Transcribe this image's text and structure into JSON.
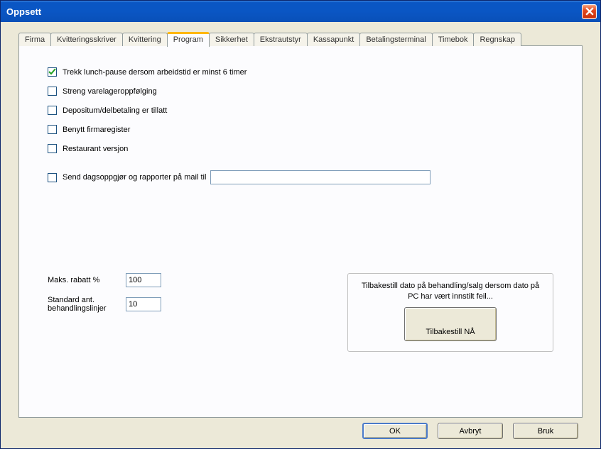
{
  "window": {
    "title": "Oppsett"
  },
  "tabs": [
    {
      "label": "Firma"
    },
    {
      "label": "Kvitteringsskriver"
    },
    {
      "label": "Kvittering"
    },
    {
      "label": "Program"
    },
    {
      "label": "Sikkerhet"
    },
    {
      "label": "Ekstrautstyr"
    },
    {
      "label": "Kassapunkt"
    },
    {
      "label": "Betalingsterminal"
    },
    {
      "label": "Timebok"
    },
    {
      "label": "Regnskap"
    }
  ],
  "active_tab": "Program",
  "program": {
    "cb1": {
      "checked": true,
      "label": "Trekk lunch-pause dersom arbeidstid er minst 6 timer"
    },
    "cb2": {
      "checked": false,
      "label": "Streng varelageroppfølging"
    },
    "cb3": {
      "checked": false,
      "label": "Depositum/delbetaling er tillatt"
    },
    "cb4": {
      "checked": false,
      "label": "Benytt firmaregister"
    },
    "cb5": {
      "checked": false,
      "label": "Restaurant versjon"
    },
    "mail": {
      "checked": false,
      "label": "Send dagsoppgjør og rapporter på mail til",
      "value": ""
    },
    "max_rabatt": {
      "label": "Maks. rabatt %",
      "value": "100"
    },
    "std_lines": {
      "label": "Standard ant. behandlingslinjer",
      "value": "10"
    },
    "reset": {
      "text": "Tilbakestill dato på behandling/salg dersom dato på PC har vært innstilt feil...",
      "button": "Tilbakestill NÅ"
    }
  },
  "buttons": {
    "ok": "OK",
    "cancel": "Avbryt",
    "apply": "Bruk"
  }
}
